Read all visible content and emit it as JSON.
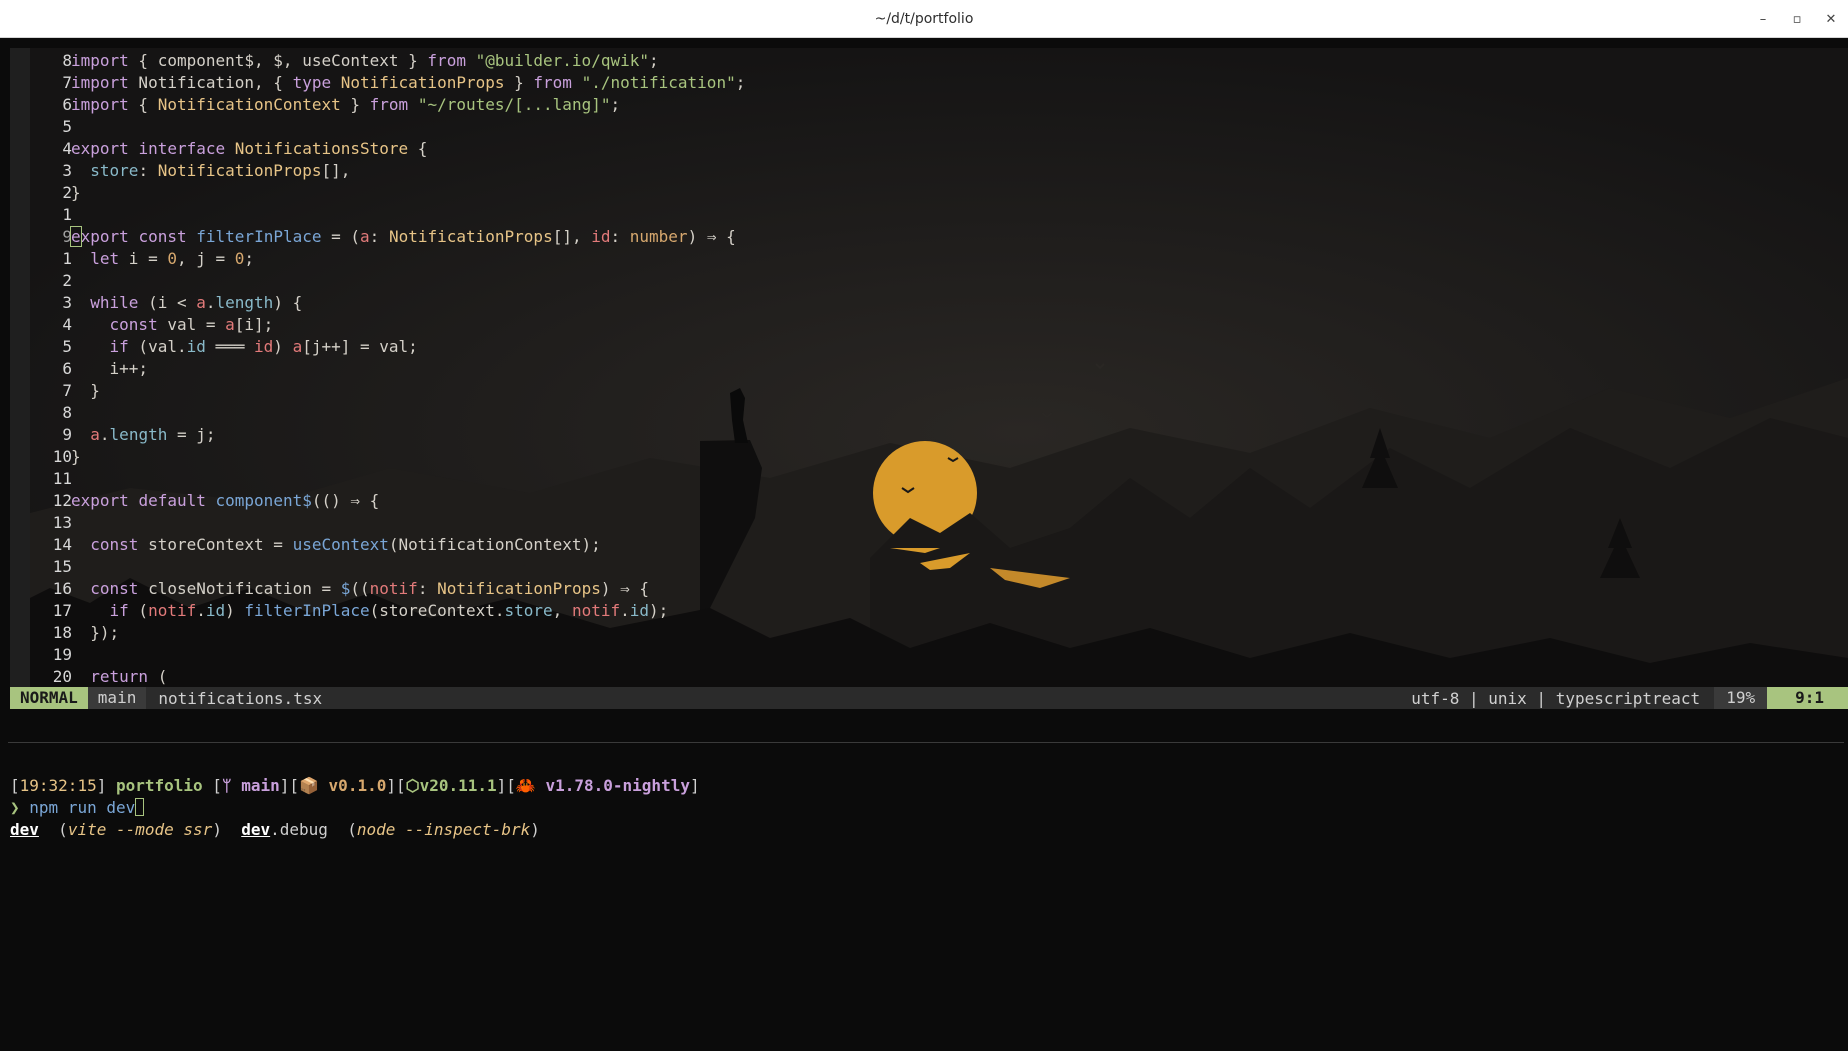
{
  "window": {
    "title": "~/d/t/portfolio"
  },
  "window_controls": {
    "minimize": "–",
    "maximize": "▫",
    "close": "✕"
  },
  "editor": {
    "lines": [
      {
        "n": "8",
        "tokens": [
          [
            "kw",
            "import"
          ],
          [
            "p",
            " { component$, $, useContext } "
          ],
          [
            "kw",
            "from"
          ],
          [
            "p",
            " "
          ],
          [
            "str",
            "\"@builder.io/qwik\""
          ],
          [
            "p",
            ";"
          ]
        ]
      },
      {
        "n": "7",
        "tokens": [
          [
            "kw",
            "import"
          ],
          [
            "p",
            " Notification, { "
          ],
          [
            "kw",
            "type"
          ],
          [
            "p",
            " "
          ],
          [
            "ty",
            "NotificationProps"
          ],
          [
            "p",
            " } "
          ],
          [
            "kw",
            "from"
          ],
          [
            "p",
            " "
          ],
          [
            "str",
            "\"./notification\""
          ],
          [
            "p",
            ";"
          ]
        ]
      },
      {
        "n": "6",
        "tokens": [
          [
            "kw",
            "import"
          ],
          [
            "p",
            " { "
          ],
          [
            "ty",
            "NotificationContext"
          ],
          [
            "p",
            " } "
          ],
          [
            "kw",
            "from"
          ],
          [
            "p",
            " "
          ],
          [
            "str",
            "\"~/routes/[...lang]\""
          ],
          [
            "p",
            ";"
          ]
        ]
      },
      {
        "n": "5",
        "tokens": []
      },
      {
        "n": "4",
        "tokens": [
          [
            "kw",
            "export"
          ],
          [
            "p",
            " "
          ],
          [
            "kw",
            "interface"
          ],
          [
            "p",
            " "
          ],
          [
            "ty",
            "NotificationsStore"
          ],
          [
            "p",
            " {"
          ]
        ]
      },
      {
        "n": "3",
        "tokens": [
          [
            "p",
            "  "
          ],
          [
            "prop",
            "store"
          ],
          [
            "p",
            ": "
          ],
          [
            "ty",
            "NotificationProps"
          ],
          [
            "p",
            "[],"
          ]
        ]
      },
      {
        "n": "2",
        "tokens": [
          [
            "p",
            "}"
          ]
        ]
      },
      {
        "n": "1",
        "tokens": []
      },
      {
        "n": "9",
        "cur": true,
        "tokens": [
          [
            "kw",
            "export"
          ],
          [
            "p",
            " "
          ],
          [
            "kw",
            "const"
          ],
          [
            "p",
            " "
          ],
          [
            "fn",
            "filterInPlace"
          ],
          [
            "p",
            " = ("
          ],
          [
            "var",
            "a"
          ],
          [
            "p",
            ": "
          ],
          [
            "ty",
            "NotificationProps"
          ],
          [
            "p",
            "[], "
          ],
          [
            "var",
            "id"
          ],
          [
            "p",
            ": "
          ],
          [
            "num",
            "number"
          ],
          [
            "p",
            ") ⇒ {"
          ]
        ]
      },
      {
        "n": "1",
        "tokens": [
          [
            "p",
            "  "
          ],
          [
            "kw",
            "let"
          ],
          [
            "p",
            " i = "
          ],
          [
            "num",
            "0"
          ],
          [
            "p",
            ", j = "
          ],
          [
            "num",
            "0"
          ],
          [
            "p",
            ";"
          ]
        ]
      },
      {
        "n": "2",
        "tokens": []
      },
      {
        "n": "3",
        "tokens": [
          [
            "p",
            "  "
          ],
          [
            "kw",
            "while"
          ],
          [
            "p",
            " (i < "
          ],
          [
            "var",
            "a"
          ],
          [
            "p",
            "."
          ],
          [
            "prop",
            "length"
          ],
          [
            "p",
            ") {"
          ]
        ]
      },
      {
        "n": "4",
        "tokens": [
          [
            "p",
            "    "
          ],
          [
            "kw",
            "const"
          ],
          [
            "p",
            " val = "
          ],
          [
            "var",
            "a"
          ],
          [
            "p",
            "[i];"
          ]
        ]
      },
      {
        "n": "5",
        "tokens": [
          [
            "p",
            "    "
          ],
          [
            "kw",
            "if"
          ],
          [
            "p",
            " (val."
          ],
          [
            "prop",
            "id"
          ],
          [
            "p",
            " ═══ "
          ],
          [
            "var",
            "id"
          ],
          [
            "p",
            ") "
          ],
          [
            "var",
            "a"
          ],
          [
            "p",
            "[j++] = val;"
          ]
        ]
      },
      {
        "n": "6",
        "tokens": [
          [
            "p",
            "    i++;"
          ]
        ]
      },
      {
        "n": "7",
        "tokens": [
          [
            "p",
            "  }"
          ]
        ]
      },
      {
        "n": "8",
        "tokens": []
      },
      {
        "n": "9",
        "tokens": [
          [
            "p",
            "  "
          ],
          [
            "var",
            "a"
          ],
          [
            "p",
            "."
          ],
          [
            "prop",
            "length"
          ],
          [
            "p",
            " = j;"
          ]
        ]
      },
      {
        "n": "10",
        "tokens": [
          [
            "p",
            "}"
          ]
        ]
      },
      {
        "n": "11",
        "tokens": []
      },
      {
        "n": "12",
        "tokens": [
          [
            "kw",
            "export"
          ],
          [
            "p",
            " "
          ],
          [
            "kw",
            "default"
          ],
          [
            "p",
            " "
          ],
          [
            "fn",
            "component$"
          ],
          [
            "p",
            "(() ⇒ {"
          ]
        ]
      },
      {
        "n": "13",
        "tokens": []
      },
      {
        "n": "14",
        "tokens": [
          [
            "p",
            "  "
          ],
          [
            "kw",
            "const"
          ],
          [
            "p",
            " storeContext = "
          ],
          [
            "fn",
            "useContext"
          ],
          [
            "p",
            "(NotificationContext);"
          ]
        ]
      },
      {
        "n": "15",
        "tokens": []
      },
      {
        "n": "16",
        "tokens": [
          [
            "p",
            "  "
          ],
          [
            "kw",
            "const"
          ],
          [
            "p",
            " closeNotification = "
          ],
          [
            "fn",
            "$"
          ],
          [
            "p",
            "(("
          ],
          [
            "var",
            "notif"
          ],
          [
            "p",
            ": "
          ],
          [
            "ty",
            "NotificationProps"
          ],
          [
            "p",
            ") ⇒ {"
          ]
        ]
      },
      {
        "n": "17",
        "tokens": [
          [
            "p",
            "    "
          ],
          [
            "kw",
            "if"
          ],
          [
            "p",
            " ("
          ],
          [
            "var",
            "notif"
          ],
          [
            "p",
            "."
          ],
          [
            "prop",
            "id"
          ],
          [
            "p",
            ") "
          ],
          [
            "fn",
            "filterInPlace"
          ],
          [
            "p",
            "(storeContext."
          ],
          [
            "prop",
            "store"
          ],
          [
            "p",
            ", "
          ],
          [
            "var",
            "notif"
          ],
          [
            "p",
            "."
          ],
          [
            "prop",
            "id"
          ],
          [
            "p",
            ");"
          ]
        ]
      },
      {
        "n": "18",
        "tokens": [
          [
            "p",
            "  });"
          ]
        ]
      },
      {
        "n": "19",
        "tokens": []
      },
      {
        "n": "20",
        "tokens": [
          [
            "p",
            "  "
          ],
          [
            "kw",
            "return"
          ],
          [
            "p",
            " ("
          ]
        ]
      }
    ]
  },
  "statusline": {
    "mode": "NORMAL",
    "branch": "main",
    "filename": "notifications.tsx",
    "fileinfo": "utf-8 | unix | typescriptreact",
    "percent": "19%",
    "position": "9:1"
  },
  "terminal": {
    "time": "19:32:15",
    "dir": "portfolio",
    "branch_icon": "ᛘ",
    "branch": "main",
    "pkg_icon": "📦",
    "pkg_version": "v0.1.0",
    "node_icon": "⬡",
    "node_version": "v20.11.1",
    "rust_icon": "🦀",
    "rust_version": "v1.78.0-nightly",
    "prompt": "❯",
    "cmd": "npm",
    "args": "run dev",
    "suggestions": [
      {
        "name": "dev",
        "suffix": "",
        "desc": "vite --mode ssr"
      },
      {
        "name": "dev",
        "suffix": ".debug",
        "desc": "node --inspect-brk"
      }
    ]
  },
  "colors": {
    "accent_green": "#a8c47f",
    "moon": "#d99b2b",
    "keyword": "#c9a0dc",
    "function": "#7aa6d6",
    "type": "#e7c487",
    "string": "#a8c47f"
  }
}
